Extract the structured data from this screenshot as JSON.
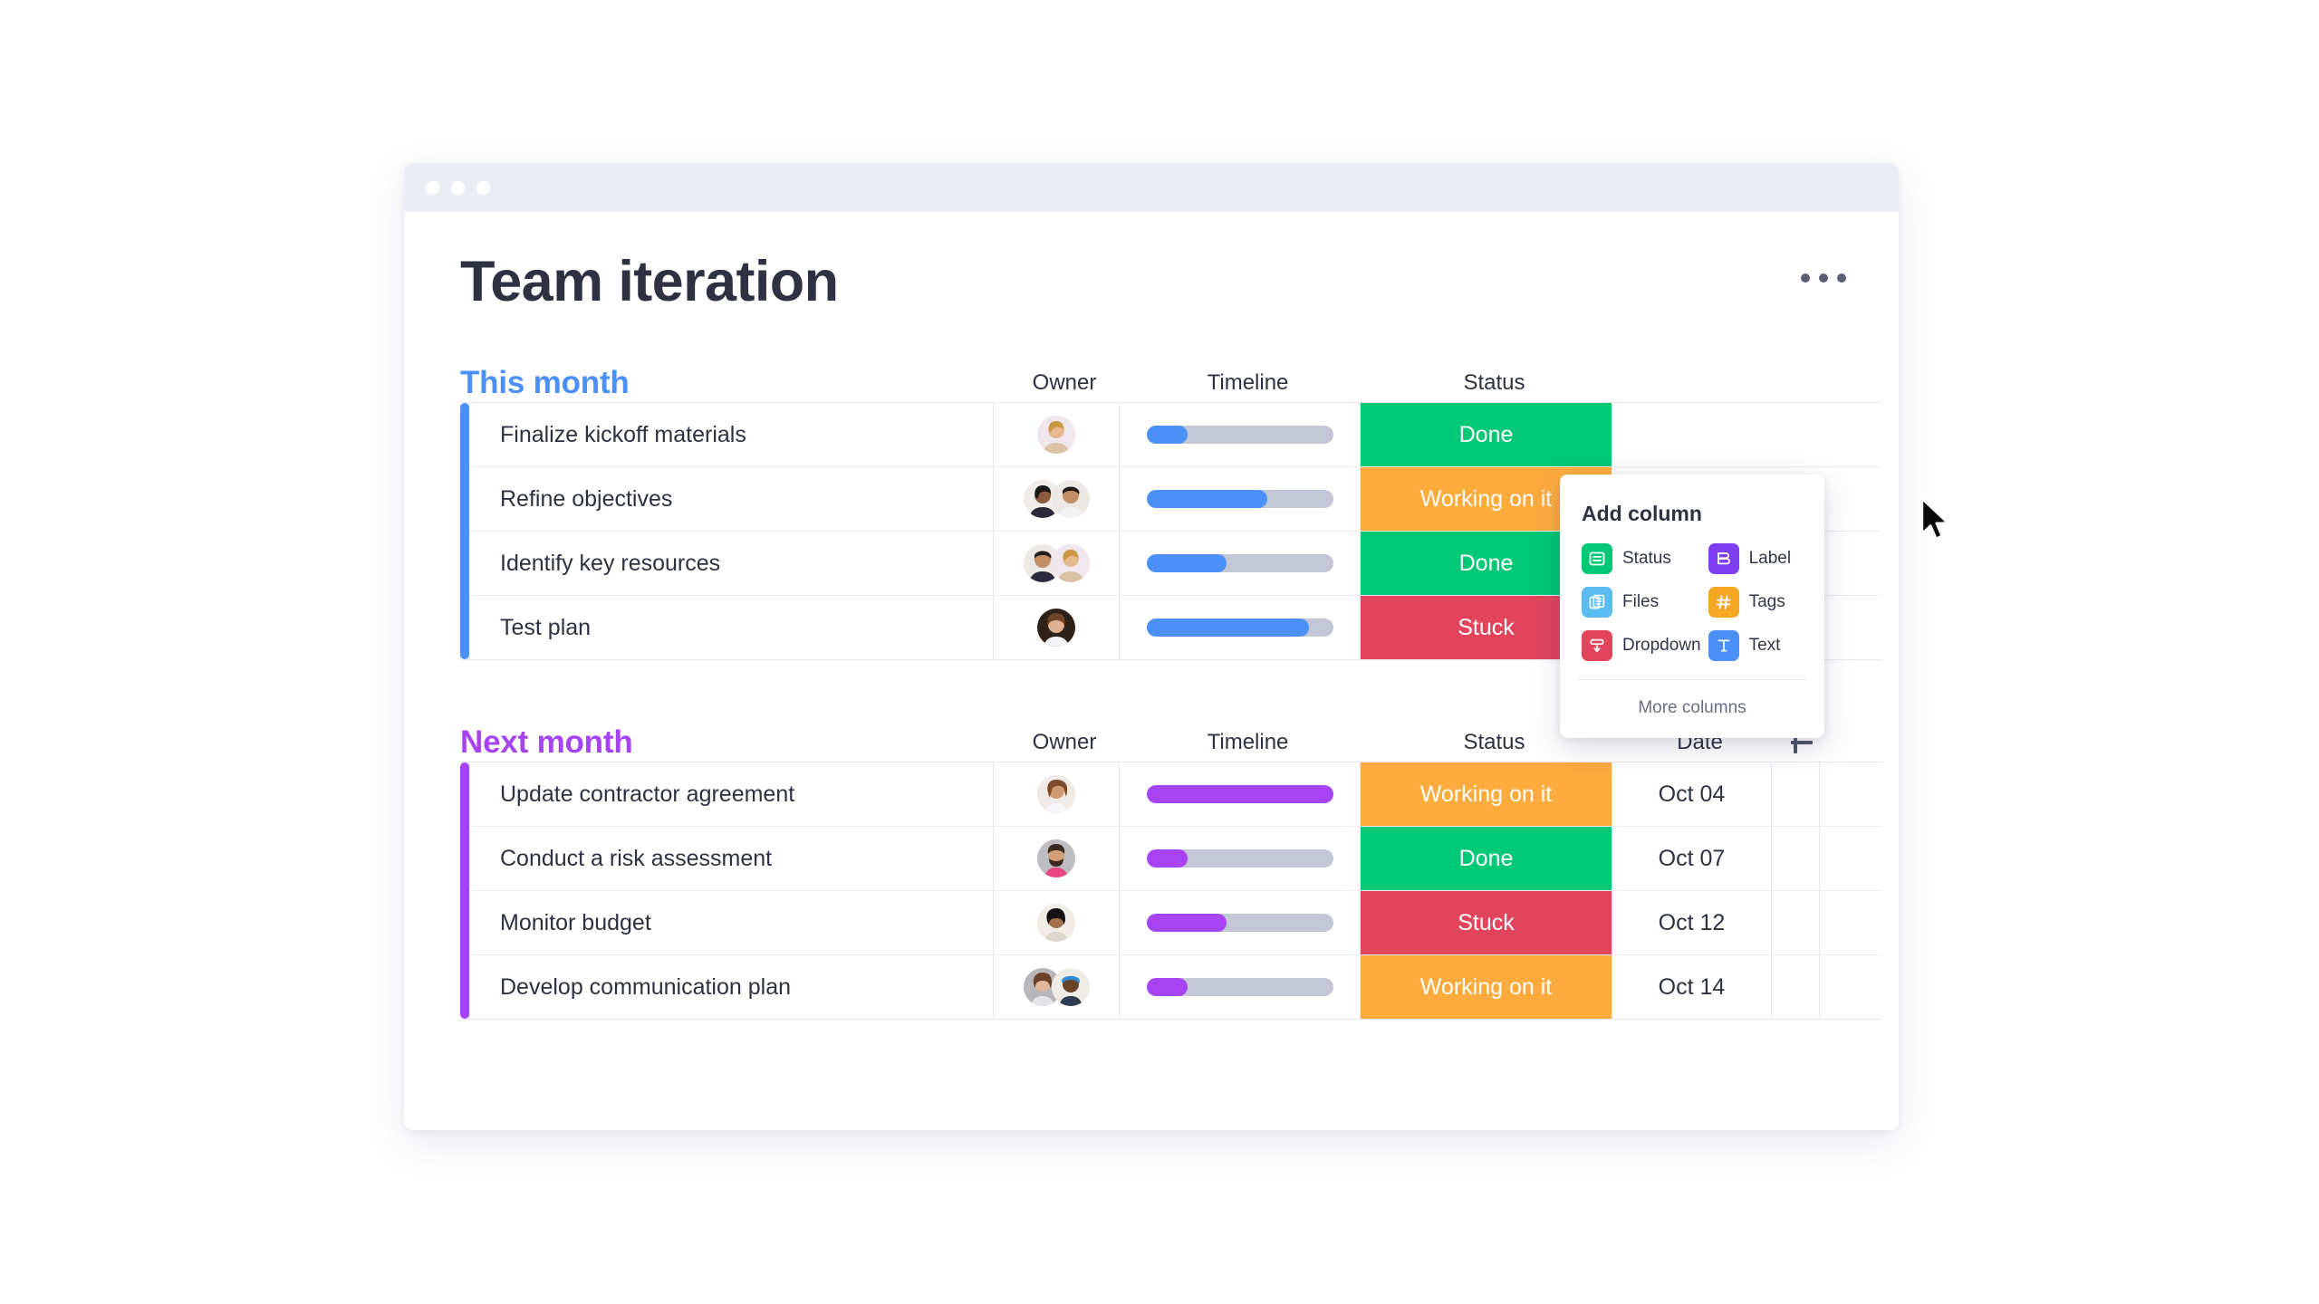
{
  "window": {
    "traffic_lights": [
      "close",
      "minimize",
      "maximize"
    ]
  },
  "header": {
    "title": "Team iteration",
    "menu_icon": "kebab-menu-icon"
  },
  "colors": {
    "status_done": "#00c875",
    "status_working": "#fdab3d",
    "status_stuck": "#e2445c",
    "group_blue": "#4a90f7",
    "group_purple": "#a644f5",
    "timeline_track": "#c3c6d4"
  },
  "groups": [
    {
      "id": "this-month",
      "title": "This month",
      "accent": "#4a90f7",
      "columns": [
        "Owner",
        "Timeline",
        "Status"
      ],
      "has_date_column": false,
      "has_add_column_button": false,
      "rows": [
        {
          "name": "Finalize kickoff materials",
          "owners": 1,
          "timeline_percent": 22,
          "status": "Done",
          "status_kind": "done"
        },
        {
          "name": "Refine objectives",
          "owners": 2,
          "timeline_percent": 65,
          "status": "Working on it",
          "status_kind": "working"
        },
        {
          "name": "Identify key resources",
          "owners": 2,
          "timeline_percent": 43,
          "status": "Done",
          "status_kind": "done"
        },
        {
          "name": "Test plan",
          "owners": 1,
          "timeline_percent": 87,
          "status": "Stuck",
          "status_kind": "stuck"
        }
      ]
    },
    {
      "id": "next-month",
      "title": "Next month",
      "accent": "#a644f5",
      "columns": [
        "Owner",
        "Timeline",
        "Status",
        "Date"
      ],
      "has_date_column": true,
      "has_add_column_button": true,
      "add_column_icon": "plus-icon",
      "rows": [
        {
          "name": "Update contractor agreement",
          "owners": 1,
          "timeline_percent": 100,
          "status": "Working on it",
          "status_kind": "working",
          "date": "Oct 04"
        },
        {
          "name": "Conduct a risk assessment",
          "owners": 1,
          "timeline_percent": 22,
          "status": "Done",
          "status_kind": "done",
          "date": "Oct 07"
        },
        {
          "name": "Monitor budget",
          "owners": 1,
          "timeline_percent": 43,
          "status": "Stuck",
          "status_kind": "stuck",
          "date": "Oct 12"
        },
        {
          "name": "Develop communication plan",
          "owners": 2,
          "timeline_percent": 22,
          "status": "Working on it",
          "status_kind": "working",
          "date": "Oct 14"
        }
      ]
    }
  ],
  "add_column_popup": {
    "title": "Add column",
    "items": [
      {
        "label": "Status",
        "icon": "status-icon",
        "color": "#00c875"
      },
      {
        "label": "Label",
        "icon": "label-icon",
        "color": "#7e3ff2"
      },
      {
        "label": "Files",
        "icon": "files-icon",
        "color": "#5bbcf2"
      },
      {
        "label": "Tags",
        "icon": "tags-icon",
        "color": "#f5a623"
      },
      {
        "label": "Dropdown",
        "icon": "dropdown-icon",
        "color": "#e2445c"
      },
      {
        "label": "Text",
        "icon": "text-icon",
        "color": "#4a90f7"
      }
    ],
    "more_label": "More columns"
  },
  "cursor": {
    "icon": "mouse-pointer-icon"
  }
}
